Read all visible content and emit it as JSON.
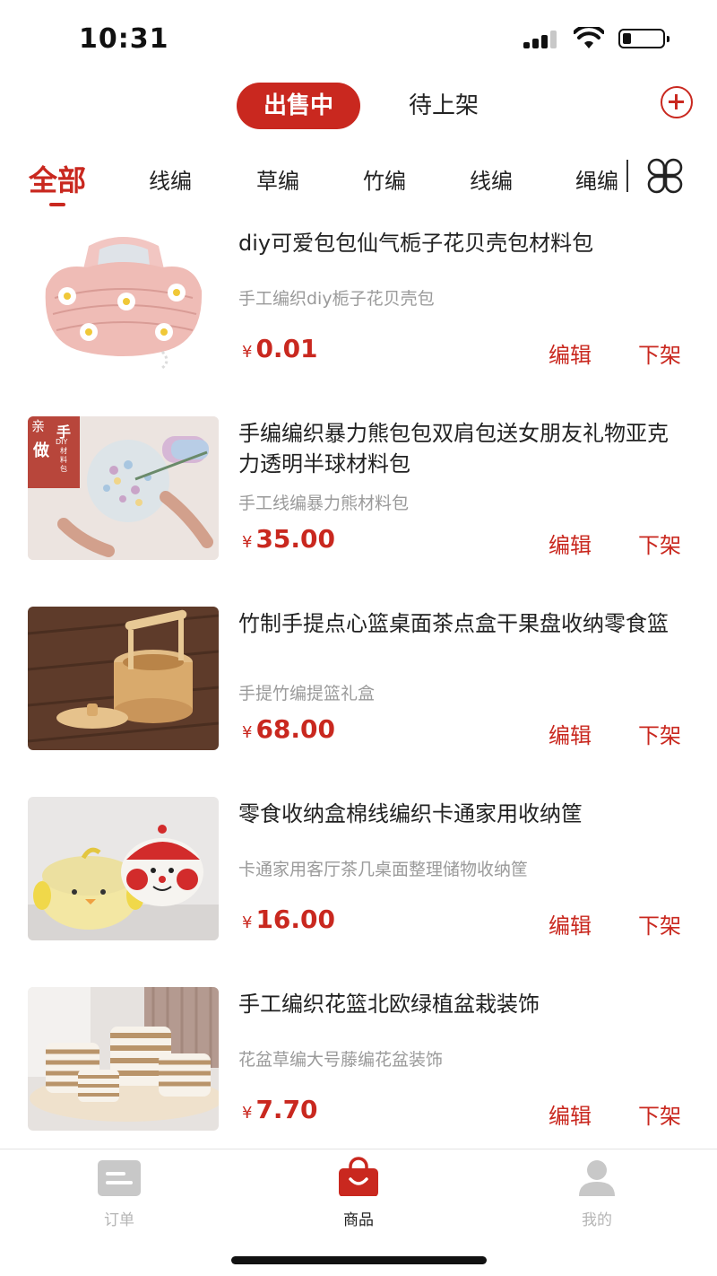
{
  "status_bar": {
    "time": "10:31",
    "battery_level": 0.2
  },
  "top_tabs": {
    "active": "出售中",
    "inactive": "待上架",
    "add_icon": "plus-circle-icon",
    "accent_color": "#c9281f"
  },
  "categories": {
    "items": [
      "全部",
      "线编",
      "草编",
      "竹编",
      "线编",
      "绳编"
    ],
    "selected": "全部",
    "grid_icon": "grid-view-icon"
  },
  "products": [
    {
      "title": "diy可爱包包仙气栀子花贝壳包材料包",
      "subtitle": "手工编织diy栀子花贝壳包",
      "currency": "¥",
      "price": "0.01",
      "edit_label": "编辑",
      "offshelf_label": "下架"
    },
    {
      "title": "手编编织暴力熊包包双肩包送女朋友礼物亚克力透明半球材料包",
      "subtitle": "手工线编暴力熊材料包",
      "currency": "¥",
      "price": "35.00",
      "edit_label": "编辑",
      "offshelf_label": "下架",
      "thumb_text": {
        "line1": "亲",
        "line2": "做",
        "line3": "手",
        "line4": "DIY",
        "line5": "材料包"
      }
    },
    {
      "title": "竹制手提点心篮桌面茶点盒干果盘收纳零食篮",
      "subtitle": "手提竹编提篮礼盒",
      "currency": "¥",
      "price": "68.00",
      "edit_label": "编辑",
      "offshelf_label": "下架"
    },
    {
      "title": "零食收纳盒棉线编织卡通家用收纳筐",
      "subtitle": "卡通家用客厅茶几桌面整理储物收纳筐",
      "currency": "¥",
      "price": "16.00",
      "edit_label": "编辑",
      "offshelf_label": "下架"
    },
    {
      "title": "手工编织花篮北欧绿植盆栽装饰",
      "subtitle": "花盆草编大号藤编花盆装饰",
      "currency": "¥",
      "price": "7.70",
      "edit_label": "编辑",
      "offshelf_label": "下架"
    }
  ],
  "bottom_nav": {
    "items": [
      {
        "label": "订单",
        "icon": "orders-icon",
        "active": false
      },
      {
        "label": "商品",
        "icon": "shopping-bag-icon",
        "active": true
      },
      {
        "label": "我的",
        "icon": "user-icon",
        "active": false
      }
    ]
  }
}
